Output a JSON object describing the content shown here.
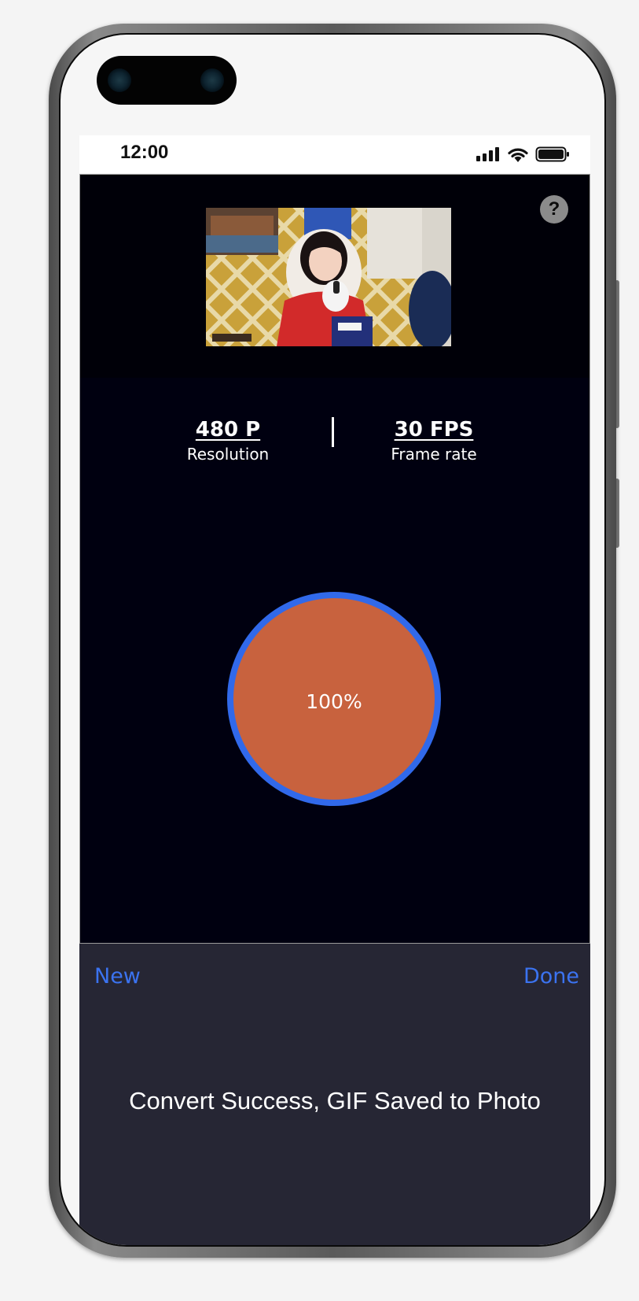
{
  "status_bar": {
    "time": "12:00",
    "icons": [
      "signal-icon",
      "wifi-icon",
      "battery-icon"
    ]
  },
  "preview": {
    "help_label": "?"
  },
  "stats": {
    "resolution_value": "480 P",
    "resolution_label": "Resolution",
    "framerate_value": "30 FPS",
    "framerate_label": "Frame rate"
  },
  "progress": {
    "value": 100,
    "label": "100%",
    "fill_color": "#c8623e",
    "ring_color": "#3169ea"
  },
  "bottom_panel": {
    "new_label": "New",
    "done_label": "Done",
    "message": "Convert Success, GIF Saved to Photo"
  },
  "colors": {
    "accent": "#3b73f0",
    "app_background": "#000010",
    "panel_background": "#262634"
  }
}
